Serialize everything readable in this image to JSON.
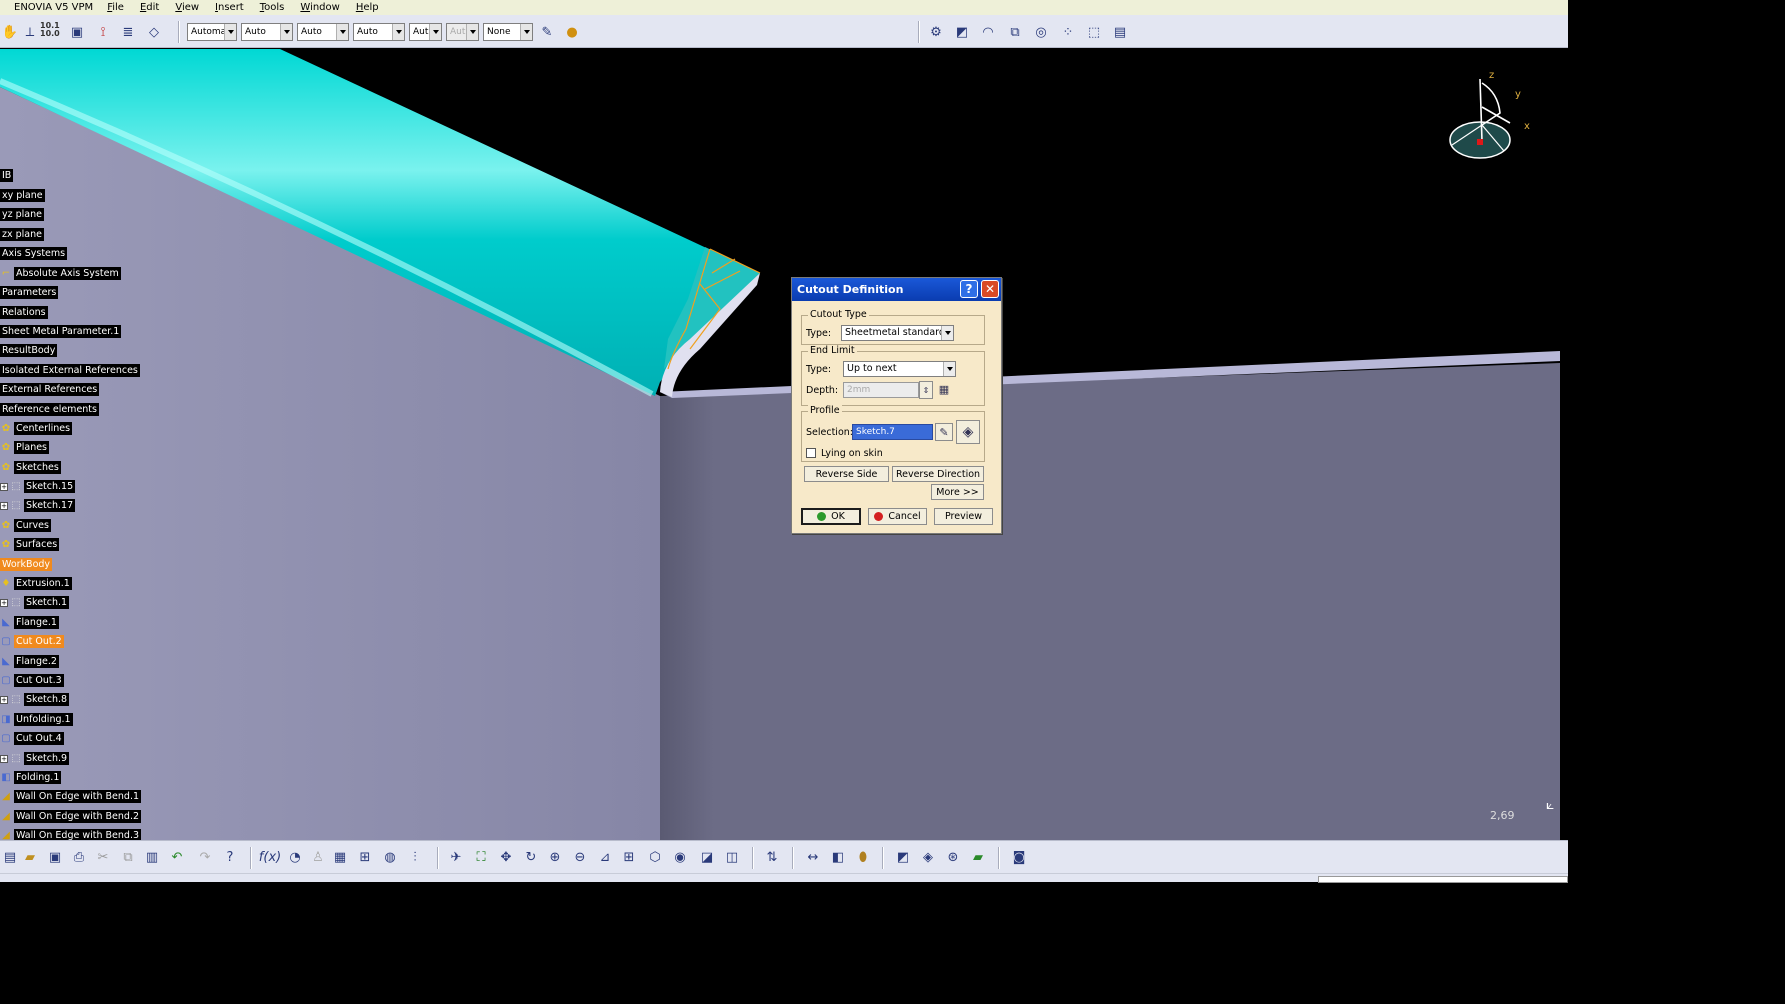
{
  "app": {
    "title": "ENOVIA V5 VPM",
    "menus": [
      "File",
      "Edit",
      "View",
      "Insert",
      "Tools",
      "Window",
      "Help"
    ]
  },
  "toolbar": {
    "combos": [
      {
        "value": "Automa",
        "disabled": false
      },
      {
        "value": "Auto",
        "disabled": false
      },
      {
        "value": "Auto",
        "disabled": false
      },
      {
        "value": "Auto",
        "disabled": false
      },
      {
        "value": "Aut",
        "disabled": false
      },
      {
        "value": "Aut",
        "disabled": true
      },
      {
        "value": "None",
        "disabled": false
      }
    ],
    "measure_icon_text": "10.1 10.0"
  },
  "tree": {
    "root": "IB",
    "items": [
      {
        "label": "xy plane",
        "icon": "plane-icon",
        "highlight": false
      },
      {
        "label": "yz plane",
        "icon": "plane-icon",
        "highlight": false
      },
      {
        "label": "zx plane",
        "icon": "plane-icon",
        "highlight": false
      },
      {
        "label": "Axis Systems",
        "icon": "folder-icon",
        "highlight": false
      },
      {
        "label": "Absolute Axis System",
        "icon": "axis-icon",
        "highlight": false
      },
      {
        "label": "Parameters",
        "icon": "parameters-icon",
        "highlight": false
      },
      {
        "label": "Relations",
        "icon": "relations-icon",
        "highlight": false
      },
      {
        "label": "Sheet Metal Parameter.1",
        "icon": "sheet-metal-icon",
        "highlight": false
      },
      {
        "label": "ResultBody",
        "icon": "body-icon",
        "highlight": false
      },
      {
        "label": "Isolated External References",
        "icon": "reference-icon",
        "highlight": false
      },
      {
        "label": "External References",
        "icon": "reference-icon",
        "highlight": false
      },
      {
        "label": "Reference elements",
        "icon": "reference-icon",
        "highlight": false
      },
      {
        "label": "Centerlines",
        "icon": "geoset-icon",
        "highlight": false
      },
      {
        "label": "Planes",
        "icon": "geoset-icon",
        "highlight": false
      },
      {
        "label": "Sketches",
        "icon": "geoset-icon",
        "highlight": false
      },
      {
        "label": "Sketch.15",
        "icon": "sketch-icon",
        "highlight": false
      },
      {
        "label": "Sketch.17",
        "icon": "sketch-icon",
        "highlight": false
      },
      {
        "label": "Curves",
        "icon": "geoset-icon",
        "highlight": false
      },
      {
        "label": "Surfaces",
        "icon": "geoset-icon",
        "highlight": false
      },
      {
        "label": "WorkBody",
        "icon": "body-icon",
        "highlight": true
      },
      {
        "label": "Extrusion.1",
        "icon": "extrusion-icon",
        "highlight": false
      },
      {
        "label": "Sketch.1",
        "icon": "sketch-icon",
        "highlight": false
      },
      {
        "label": "Flange.1",
        "icon": "flange-icon",
        "highlight": false
      },
      {
        "label": "Cut Out.2",
        "icon": "cutout-icon",
        "highlight": true
      },
      {
        "label": "Flange.2",
        "icon": "flange-icon",
        "highlight": false
      },
      {
        "label": "Cut Out.3",
        "icon": "cutout-icon",
        "highlight": false
      },
      {
        "label": "Sketch.8",
        "icon": "sketch-icon",
        "highlight": false
      },
      {
        "label": "Unfolding.1",
        "icon": "unfolding-icon",
        "highlight": false
      },
      {
        "label": "Cut Out.4",
        "icon": "cutout-icon",
        "highlight": false
      },
      {
        "label": "Sketch.9",
        "icon": "sketch-icon",
        "highlight": false
      },
      {
        "label": "Folding.1",
        "icon": "folding-icon",
        "highlight": false
      },
      {
        "label": "Wall On Edge with Bend.1",
        "icon": "wall-icon",
        "highlight": false
      },
      {
        "label": "Wall On Edge with Bend.2",
        "icon": "wall-icon",
        "highlight": false
      },
      {
        "label": "Wall On Edge with Bend.3",
        "icon": "wall-icon",
        "highlight": false
      }
    ]
  },
  "compass": {
    "x": "x",
    "y": "y",
    "z": "z"
  },
  "viewport": {
    "zoom_readout": "2,69"
  },
  "dialog": {
    "title": "Cutout Definition",
    "help_glyph": "?",
    "close_glyph": "✕",
    "cutout_type": {
      "group": "Cutout Type",
      "type_label": "Type:",
      "type_value": "Sheetmetal standard"
    },
    "end_limit": {
      "group": "End Limit",
      "type_label": "Type:",
      "type_value": "Up to next",
      "depth_label": "Depth:",
      "depth_value": "2mm"
    },
    "profile": {
      "group": "Profile",
      "selection_label": "Selection:",
      "selection_value": "Sketch.7",
      "lying_on_skin": "Lying on skin",
      "lying_on_skin_checked": false
    },
    "buttons": {
      "reverse_side": "Reverse Side",
      "reverse_direction": "Reverse Direction",
      "more": "More >>",
      "ok": "OK",
      "cancel": "Cancel",
      "preview": "Preview"
    }
  },
  "colors": {
    "part_face": "#00cccc",
    "body_gray": "#8e8eb0",
    "wall_gray": "#6a6a84",
    "edge_highlight": "#f0a020",
    "ok_green": "#2c9a2c",
    "cancel_red": "#d42020"
  }
}
